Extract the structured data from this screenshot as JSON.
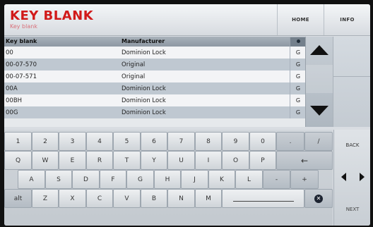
{
  "header": {
    "title": "KEY BLANK",
    "subtitle": "Key blank",
    "home_label": "HOME",
    "info_label": "INFO"
  },
  "table": {
    "columns": {
      "key_blank": "Key blank",
      "manufacturer": "Manufacturer"
    },
    "rows": [
      {
        "key": "00",
        "manufacturer": "Dominion Lock",
        "type": "G"
      },
      {
        "key": "00-07-570",
        "manufacturer": "Original",
        "type": "G"
      },
      {
        "key": "00-07-571",
        "manufacturer": "Original",
        "type": "G"
      },
      {
        "key": "00A",
        "manufacturer": "Dominion Lock",
        "type": "G"
      },
      {
        "key": "00BH",
        "manufacturer": "Dominion Lock",
        "type": "G"
      },
      {
        "key": "00G",
        "manufacturer": "Dominion Lock",
        "type": "G"
      }
    ]
  },
  "keyboard": {
    "row1": [
      "1",
      "2",
      "3",
      "4",
      "5",
      "6",
      "7",
      "8",
      "9",
      "0",
      ".",
      "/"
    ],
    "row2": [
      "Q",
      "W",
      "E",
      "R",
      "T",
      "Y",
      "U",
      "I",
      "O",
      "P",
      "←"
    ],
    "row3": [
      "A",
      "S",
      "D",
      "F",
      "G",
      "H",
      "J",
      "K",
      "L",
      "-",
      "+"
    ],
    "row4": [
      "alt",
      "Z",
      "X",
      "C",
      "V",
      "B",
      "N",
      "M"
    ]
  },
  "side": {
    "back_label": "BACK",
    "next_label": "NEXT"
  },
  "colors": {
    "title": "#d11a1a",
    "row_alt": "#bfc8d1",
    "header_bar": "#8d98a3"
  }
}
